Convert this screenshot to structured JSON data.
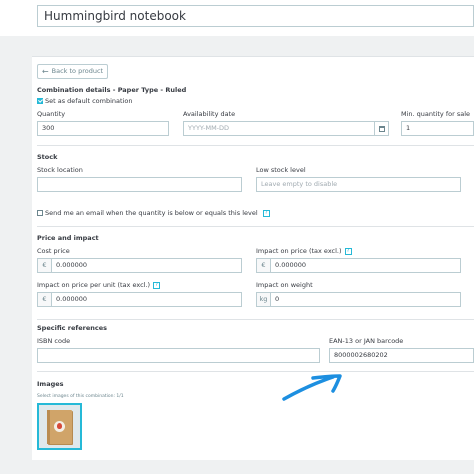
{
  "header": {
    "product_name": "Hummingbird notebook"
  },
  "back_button": {
    "label": "Back to product",
    "icon": "arrow-left-icon"
  },
  "combination": {
    "title": "Combination details - Paper Type - Ruled",
    "default_checkbox": {
      "label": "Set as default combination",
      "checked": true
    },
    "quantity": {
      "label": "Quantity",
      "value": "300"
    },
    "availability_date": {
      "label": "Availability date",
      "placeholder": "YYYY-MM-DD",
      "icon": "calendar-icon"
    },
    "min_quantity": {
      "label": "Min. quantity for sale",
      "value": "1"
    }
  },
  "stock": {
    "title": "Stock",
    "location": {
      "label": "Stock location",
      "value": ""
    },
    "low_stock": {
      "label": "Low stock level",
      "placeholder": "Leave empty to disable"
    },
    "email_checkbox": {
      "label": "Send me an email when the quantity is below or equals this level",
      "checked": false
    }
  },
  "price": {
    "title": "Price and impact",
    "cost_price": {
      "label": "Cost price",
      "currency": "€",
      "value": "0.000000"
    },
    "impact_tax_excl": {
      "label": "Impact on price (tax excl.)",
      "currency": "€",
      "value": "0.000000"
    },
    "impact_per_unit": {
      "label": "Impact on price per unit (tax excl.)",
      "currency": "€",
      "value": "0.000000"
    },
    "impact_weight": {
      "label": "Impact on weight",
      "unit": "kg",
      "value": "0"
    },
    "help_glyph": "?"
  },
  "references": {
    "title": "Specific references",
    "isbn": {
      "label": "ISBN code",
      "value": ""
    },
    "ean13": {
      "label": "EAN-13 or JAN barcode",
      "value": "8000002680202"
    }
  },
  "images": {
    "title": "Images",
    "caption": "Select images of this combination: 1/1"
  },
  "colors": {
    "accent": "#25b9d7",
    "annotation": "#1d8fe0",
    "border": "#bbcdd2"
  }
}
